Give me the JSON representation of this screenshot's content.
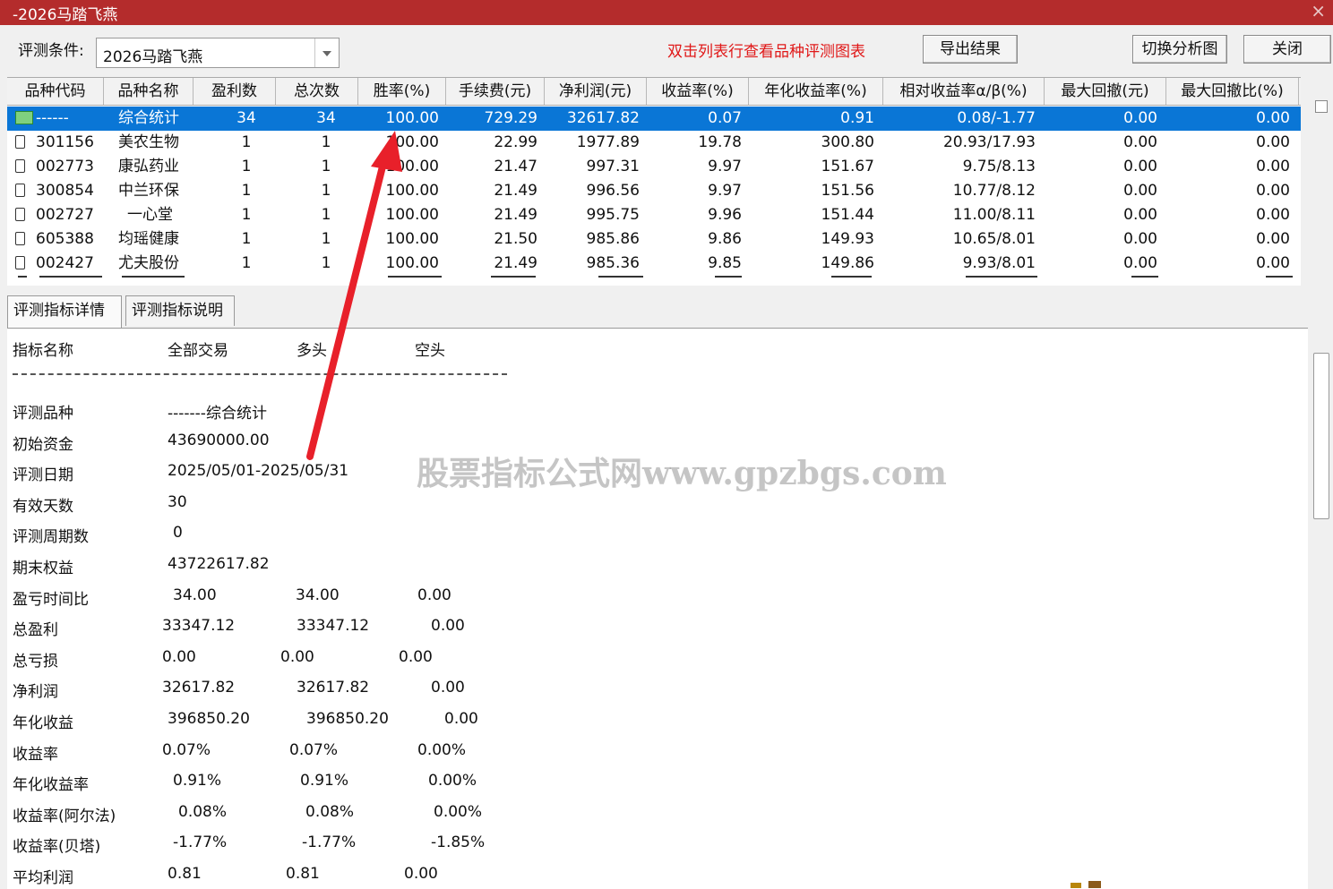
{
  "window": {
    "title": "-2026马踏飞燕",
    "close_glyph": "×"
  },
  "toolbar": {
    "condition_label": "评测条件:",
    "condition_value": "2026马踏飞燕",
    "hint": "双击列表行查看品种评测图表",
    "export_label": "导出结果",
    "switch_label": "切换分析图",
    "close_label": "关闭"
  },
  "grid": {
    "columns": [
      "品种代码",
      "品种名称",
      "盈利数",
      "总次数",
      "胜率(%)",
      "手续费(元)",
      "净利润(元)",
      "收益率(%)",
      "年化收益率(%)",
      "相对收益率α/β(%)",
      "最大回撤(元)",
      "最大回撤比(%)"
    ],
    "rows": [
      {
        "code": "------",
        "name": "综合统计",
        "wins": "34",
        "total": "34",
        "winrate": "100.00",
        "fee": "729.29",
        "profit": "32617.82",
        "ret": "0.07",
        "annual": "0.91",
        "relative": "0.08/-1.77",
        "maxdd": "0.00",
        "maxddr": "0.00"
      },
      {
        "code": "301156",
        "name": "美农生物",
        "wins": "1",
        "total": "1",
        "winrate": "100.00",
        "fee": "22.99",
        "profit": "1977.89",
        "ret": "19.78",
        "annual": "300.80",
        "relative": "20.93/17.93",
        "maxdd": "0.00",
        "maxddr": "0.00"
      },
      {
        "code": "002773",
        "name": "康弘药业",
        "wins": "1",
        "total": "1",
        "winrate": "100.00",
        "fee": "21.47",
        "profit": "997.31",
        "ret": "9.97",
        "annual": "151.67",
        "relative": "9.75/8.13",
        "maxdd": "0.00",
        "maxddr": "0.00"
      },
      {
        "code": "300854",
        "name": "中兰环保",
        "wins": "1",
        "total": "1",
        "winrate": "100.00",
        "fee": "21.49",
        "profit": "996.56",
        "ret": "9.97",
        "annual": "151.56",
        "relative": "10.77/8.12",
        "maxdd": "0.00",
        "maxddr": "0.00"
      },
      {
        "code": "002727",
        "name": "一心堂",
        "wins": "1",
        "total": "1",
        "winrate": "100.00",
        "fee": "21.49",
        "profit": "995.75",
        "ret": "9.96",
        "annual": "151.44",
        "relative": "11.00/8.11",
        "maxdd": "0.00",
        "maxddr": "0.00"
      },
      {
        "code": "605388",
        "name": "均瑶健康",
        "wins": "1",
        "total": "1",
        "winrate": "100.00",
        "fee": "21.50",
        "profit": "985.86",
        "ret": "9.86",
        "annual": "149.93",
        "relative": "10.65/8.01",
        "maxdd": "0.00",
        "maxddr": "0.00"
      },
      {
        "code": "002427",
        "name": "尤夫股份",
        "wins": "1",
        "total": "1",
        "winrate": "100.00",
        "fee": "21.49",
        "profit": "985.36",
        "ret": "9.85",
        "annual": "149.86",
        "relative": "9.93/8.01",
        "maxdd": "0.00",
        "maxddr": "0.00"
      }
    ]
  },
  "tabs": [
    "评测指标详情",
    "评测指标说明"
  ],
  "detail": {
    "headers": [
      "指标名称",
      "全部交易",
      "多头",
      "空头"
    ],
    "info": [
      {
        "label": "评测品种",
        "value": "-------综合统计"
      },
      {
        "label": "初始资金",
        "value": "43690000.00"
      },
      {
        "label": "评测日期",
        "value": "2025/05/01-2025/05/31"
      },
      {
        "label": "有效天数",
        "value": "30"
      },
      {
        "label": "评测周期数",
        "value": "0"
      },
      {
        "label": "期末权益",
        "value": "43722617.82"
      }
    ],
    "metrics": [
      {
        "label": "盈亏时间比",
        "all": "34.00",
        "long": "34.00",
        "short": "0.00"
      },
      {
        "label": "总盈利",
        "all": "33347.12",
        "long": "33347.12",
        "short": "0.00"
      },
      {
        "label": "总亏损",
        "all": "0.00",
        "long": "0.00",
        "short": "0.00"
      },
      {
        "label": "净利润",
        "all": "32617.82",
        "long": "32617.82",
        "short": "0.00"
      },
      {
        "label": "年化收益",
        "all": "396850.20",
        "long": "396850.20",
        "short": "0.00"
      },
      {
        "label": "收益率",
        "all": "0.07%",
        "long": "0.07%",
        "short": "0.00%"
      },
      {
        "label": "年化收益率",
        "all": "0.91%",
        "long": "0.91%",
        "short": "0.00%"
      },
      {
        "label": "收益率(阿尔法)",
        "all": "0.08%",
        "long": "0.08%",
        "short": "0.00%"
      },
      {
        "label": "收益率(贝塔)",
        "all": "-1.77%",
        "long": "-1.77%",
        "short": "-1.85%"
      },
      {
        "label": "平均利润",
        "all": "0.81",
        "long": "0.81",
        "short": "0.00"
      }
    ]
  },
  "watermark": "股票指标公式网www.gpzbgs.com",
  "colors": {
    "titlebar": "#b42c2c",
    "selection": "#0a76d6",
    "hint": "#e01818",
    "arrow": "#e8202a"
  }
}
